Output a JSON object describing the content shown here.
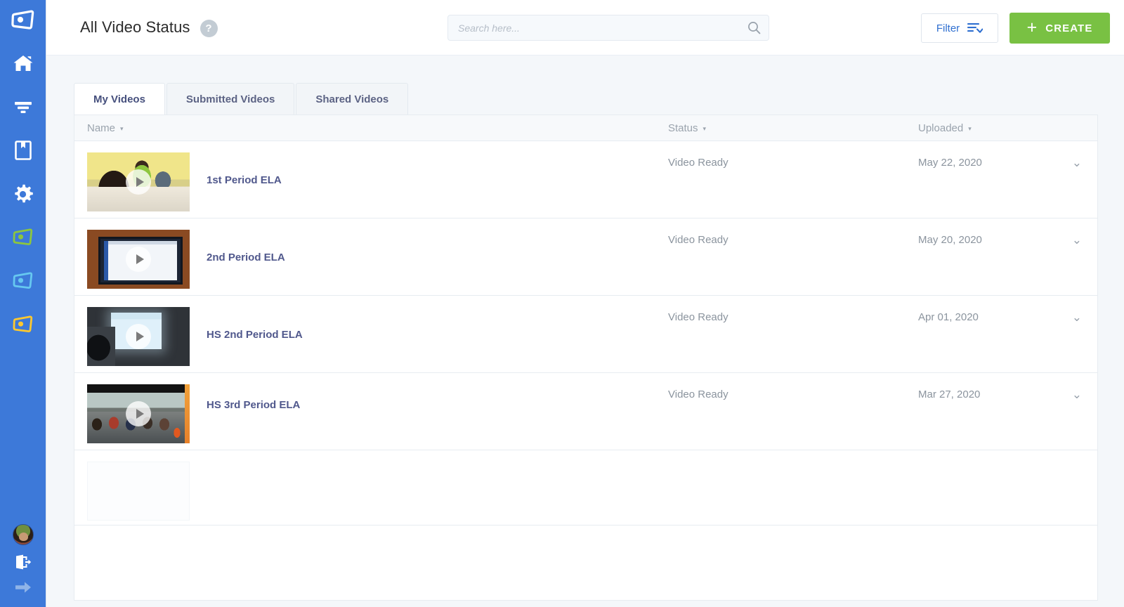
{
  "brand": {
    "logo_icon": "video-screen-logo",
    "sidebar_bg": "#3d79d9",
    "accent_blue": "#2f6fd0",
    "accent_green": "#79c143",
    "name_link_color": "#50588c"
  },
  "sidebar": {
    "items": [
      {
        "icon": "home-icon",
        "label": "Home"
      },
      {
        "icon": "filter-icon",
        "label": "Filter"
      },
      {
        "icon": "bookmark-icon",
        "label": "Library"
      },
      {
        "icon": "gear-icon",
        "label": "Settings"
      },
      {
        "icon": "video-green-icon",
        "label": "My Videos"
      },
      {
        "icon": "video-blue-icon",
        "label": "Shared Videos"
      },
      {
        "icon": "video-yellow-icon",
        "label": "Submitted Videos"
      }
    ],
    "bottom": [
      {
        "icon": "avatar",
        "label": "Account"
      },
      {
        "icon": "logout-icon",
        "label": "Log out"
      },
      {
        "icon": "arrow-right-icon",
        "label": "Expand menu"
      }
    ]
  },
  "header": {
    "title": "All Video Status",
    "help_icon": "question-mark-icon",
    "help_label": "?"
  },
  "search": {
    "placeholder": "Search here...",
    "value": "",
    "icon": "search-icon"
  },
  "toolbar": {
    "filter_label": "Filter",
    "filter_icon": "sort-filter-icon",
    "create_label": "CREATE",
    "create_icon": "plus-icon"
  },
  "tabs": [
    {
      "label": "My Videos",
      "active": true
    },
    {
      "label": "Submitted Videos",
      "active": false
    },
    {
      "label": "Shared Videos",
      "active": false
    }
  ],
  "table": {
    "columns": [
      {
        "label": "Name",
        "sort_icon": "caret-down-icon"
      },
      {
        "label": "Status",
        "sort_icon": "caret-down-icon"
      },
      {
        "label": "Uploaded",
        "sort_icon": "caret-down-icon"
      }
    ],
    "caret": "▾",
    "rows": [
      {
        "name": "1st Period ELA",
        "status": "Video Ready",
        "uploaded": "May 22, 2020",
        "thumbnail": "classroom-students-yellow-wall",
        "play_icon": "play-icon",
        "expand_icon": "chevron-down-icon"
      },
      {
        "name": "2nd Period ELA",
        "status": "Video Ready",
        "uploaded": "May 20, 2020",
        "thumbnail": "computer-monitor-screen",
        "play_icon": "play-icon",
        "expand_icon": "chevron-down-icon"
      },
      {
        "name": "HS 2nd Period ELA",
        "status": "Video Ready",
        "uploaded": "Apr 01, 2020",
        "thumbnail": "dark-classroom-projector-screen",
        "play_icon": "play-icon",
        "expand_icon": "chevron-down-icon"
      },
      {
        "name": "HS 3rd Period ELA",
        "status": "Video Ready",
        "uploaded": "Mar 27, 2020",
        "thumbnail": "lecture-hall-students",
        "play_icon": "play-icon",
        "expand_icon": "chevron-down-icon"
      },
      {
        "name": "",
        "status": "",
        "uploaded": "",
        "thumbnail": "empty-placeholder",
        "play_icon": "",
        "expand_icon": ""
      },
      {
        "name": "",
        "status": "",
        "uploaded": "",
        "thumbnail": "",
        "play_icon": "",
        "expand_icon": ""
      }
    ]
  }
}
